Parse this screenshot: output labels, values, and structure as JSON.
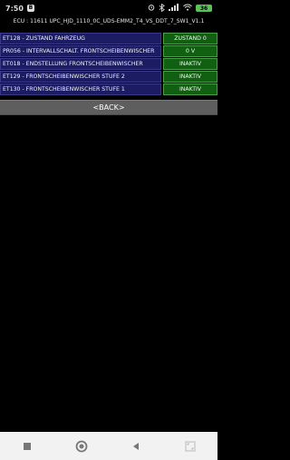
{
  "statusbar": {
    "time": "7:50",
    "b_icon": "B",
    "battery": "36",
    "icons": [
      "alarm-icon",
      "bluetooth-icon",
      "signal-icon",
      "wifi-icon",
      "battery-icon"
    ]
  },
  "ecu_title": "ECU : 11611  UPC_HJD_1110_0C_UDS-EMM2_T4_VS_DDT_7_SW1_V1.1",
  "rows": [
    {
      "label": "ET128 - ZUSTAND FAHRZEUG",
      "value": "ZUSTAND 0"
    },
    {
      "label": "PR056 - INTERVALLSCHALT. FRONTSCHEIBENWISCHER",
      "value": "0 V"
    },
    {
      "label": "ET018 - ENDSTELLUNG FRONTSCHEIBENWISCHER",
      "value": "INAKTIV"
    },
    {
      "label": "ET129 - FRONTSCHEIBENWISCHER STUFE 2",
      "value": "INAKTIV"
    },
    {
      "label": "ET130 - FRONTSCHEIBENWISCHER STUFE 1",
      "value": "INAKTIV"
    }
  ],
  "back_button": "<BACK>",
  "navbar": {
    "icons": [
      "recents-square-icon",
      "home-circle-icon",
      "back-triangle-icon",
      "screenshot-icon"
    ]
  },
  "colors": {
    "label_bg": "#1c1c63",
    "value_bg": "#115f11",
    "back_bg": "#5e5e5e",
    "background": "#000000"
  }
}
